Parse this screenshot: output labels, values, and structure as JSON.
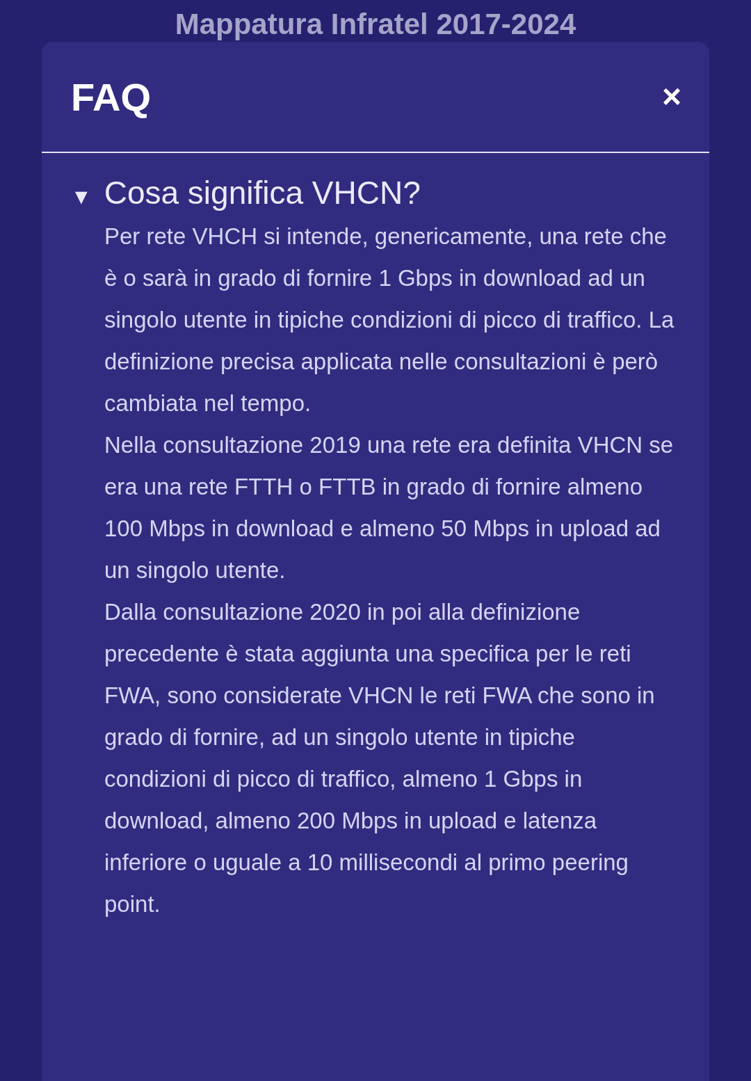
{
  "page_title": "Mappatura Infratel 2017-2024",
  "dialog": {
    "title": "FAQ",
    "close": "×",
    "items": [
      {
        "marker": "▼",
        "question": "Cosa significa VHCN?",
        "expanded": true,
        "answer": [
          "Per rete VHCH si intende, genericamente, una rete che è o sarà in grado di fornire 1 Gbps in download ad un singolo utente in tipiche condizioni di picco di traffico. La definizione precisa applicata nelle consultazioni è però cambiata nel tempo.",
          "Nella consultazione 2019 una rete era definita VHCN se era una rete FTTH o FTTB in grado di fornire almeno 100 Mbps in download e almeno 50 Mbps in upload ad un singolo utente.",
          "Dalla consultazione 2020 in poi alla definizione precedente è stata aggiunta una specifica per le reti FWA, sono considerate VHCN le reti FWA che sono in grado di fornire, ad un singolo utente in tipiche condizioni di picco di traffico, almeno 1 Gbps in download, almeno 200 Mbps in upload e latenza inferiore o uguale a 10 millisecondi al primo peering point."
        ]
      }
    ]
  }
}
